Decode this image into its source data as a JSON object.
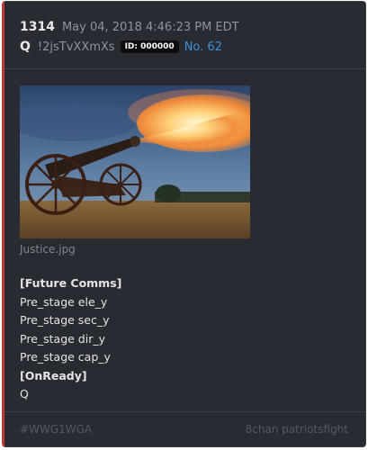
{
  "post": {
    "number": "1314",
    "date": "May 04, 2018 4:46:23 PM EDT",
    "name": "Q",
    "tripcode": "!2jsTvXXmXs",
    "id_badge": "ID: 000000",
    "post_no": "No. 62",
    "image": {
      "icon": "cannon-firing-photo",
      "filename": "Justice.jpg"
    },
    "body_lines": [
      {
        "text": "[Future Comms]",
        "bold": true
      },
      {
        "text": "Pre_stage ele_y",
        "bold": false
      },
      {
        "text": "Pre_stage sec_y",
        "bold": false
      },
      {
        "text": "Pre_stage dir_y",
        "bold": false
      },
      {
        "text": "Pre_stage cap_y",
        "bold": false
      },
      {
        "text": "[OnReady]",
        "bold": true
      },
      {
        "text": "Q",
        "bold": false
      }
    ]
  },
  "footer": {
    "hashtag": "#WWG1WGA",
    "source": "8chan patriotsfight"
  },
  "colors": {
    "card_background": "#282b31",
    "accent_bar": "#c0383a",
    "link_blue": "#3f8fd6",
    "muted_text": "#8f949b"
  }
}
